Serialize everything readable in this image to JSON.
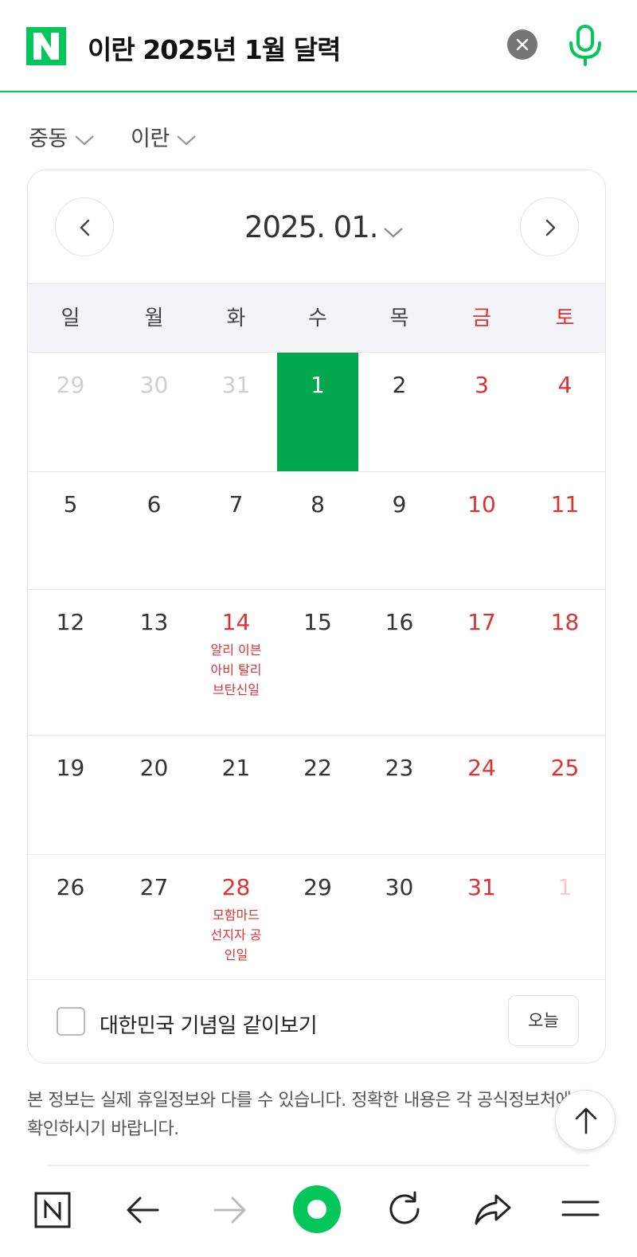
{
  "search": {
    "query": "이란 2025년 1월 달력"
  },
  "selectors": {
    "region": "중동",
    "country": "이란"
  },
  "calendar": {
    "month_label": "2025. 01.",
    "weekdays": [
      "일",
      "월",
      "화",
      "수",
      "목",
      "금",
      "토"
    ],
    "weeks": [
      [
        {
          "day": "29",
          "other": true
        },
        {
          "day": "30",
          "other": true
        },
        {
          "day": "31",
          "other": true
        },
        {
          "day": "1",
          "today": true
        },
        {
          "day": "2"
        },
        {
          "day": "3",
          "weekend": true
        },
        {
          "day": "4",
          "weekend": true
        }
      ],
      [
        {
          "day": "5"
        },
        {
          "day": "6"
        },
        {
          "day": "7"
        },
        {
          "day": "8"
        },
        {
          "day": "9"
        },
        {
          "day": "10",
          "weekend": true
        },
        {
          "day": "11",
          "weekend": true
        }
      ],
      [
        {
          "day": "12"
        },
        {
          "day": "13"
        },
        {
          "day": "14",
          "holiday": true,
          "holiday_name": "알리 이븐 아비 탈리브탄신일"
        },
        {
          "day": "15"
        },
        {
          "day": "16"
        },
        {
          "day": "17",
          "weekend": true
        },
        {
          "day": "18",
          "weekend": true
        }
      ],
      [
        {
          "day": "19"
        },
        {
          "day": "20"
        },
        {
          "day": "21"
        },
        {
          "day": "22"
        },
        {
          "day": "23"
        },
        {
          "day": "24",
          "weekend": true
        },
        {
          "day": "25",
          "weekend": true
        }
      ],
      [
        {
          "day": "26"
        },
        {
          "day": "27"
        },
        {
          "day": "28",
          "holiday": true,
          "holiday_name": "모함마드 선지자 공인일"
        },
        {
          "day": "29"
        },
        {
          "day": "30"
        },
        {
          "day": "31",
          "weekend": true
        },
        {
          "day": "1",
          "other": true,
          "weekend": true
        }
      ]
    ],
    "compare_label": "대한민국 기념일 같이보기",
    "today_button": "오늘"
  },
  "disclaimer": "본 정보는 실제 휴일정보와 다를 수 있습니다. 정확한 내용은 각 공식정보처에서 확인하시기 바랍니다.",
  "colors": {
    "brand_green": "#03c75a",
    "today_fill": "#03a84e",
    "holiday_red": "#e03131"
  },
  "toolbar_icons": [
    "naver-home-icon",
    "back-arrow-icon",
    "forward-arrow-icon",
    "green-dot-icon",
    "refresh-icon",
    "share-icon",
    "menu-icon"
  ]
}
